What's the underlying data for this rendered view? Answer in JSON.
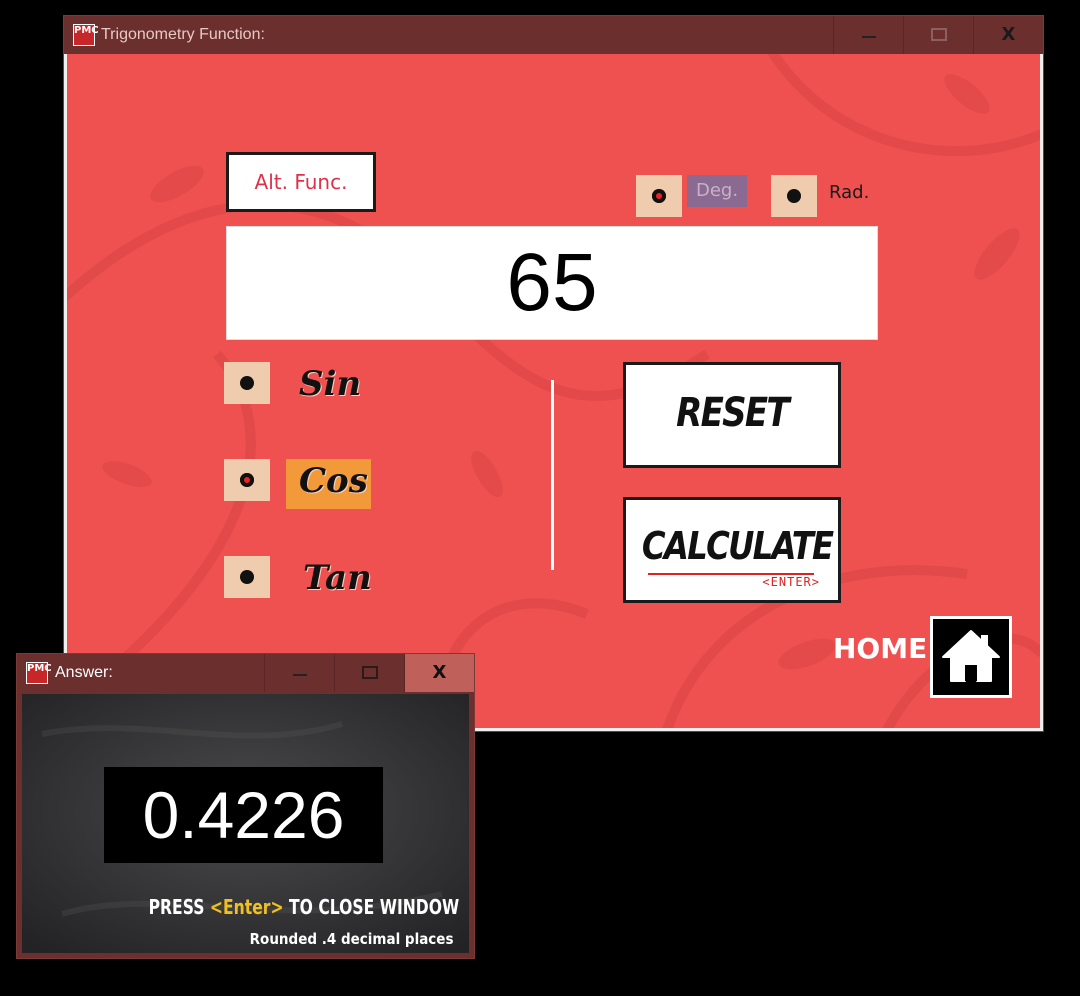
{
  "main_window": {
    "title": "Trigonometry Function:",
    "app_icon_text": "PMC",
    "controls": {
      "minimize": "minimize",
      "maximize": "maximize",
      "close": "X"
    },
    "alt_func_label": "Alt. Func.",
    "angle_mode": {
      "deg_label": "Deg.",
      "rad_label": "Rad.",
      "selected": "Deg."
    },
    "display_value": "65",
    "functions": [
      {
        "label": "Sin",
        "selected": false
      },
      {
        "label": "Cos",
        "selected": true
      },
      {
        "label": "Tan",
        "selected": false
      }
    ],
    "reset_label": "RESET",
    "calculate_label": "CALCULATE",
    "calculate_hint": "<ENTER>",
    "home_label": "HOME",
    "colors": {
      "background": "#ef5050",
      "titlebar": "#6b2f2e",
      "selected_function": "#f29a3a",
      "radio_bg": "#f0ccae"
    }
  },
  "answer_window": {
    "title": "Answer:",
    "app_icon_text": "PMC",
    "controls": {
      "minimize": "minimize",
      "maximize": "maximize",
      "close": "X"
    },
    "value": "0.4226",
    "instruction_prefix": "PRESS ",
    "instruction_key": "<Enter>",
    "instruction_suffix": " TO CLOSE WINDOW",
    "note": "Rounded .4 decimal places",
    "colors": {
      "chalkboard": "#3c3c3e",
      "key_highlight": "#f0c020"
    }
  }
}
